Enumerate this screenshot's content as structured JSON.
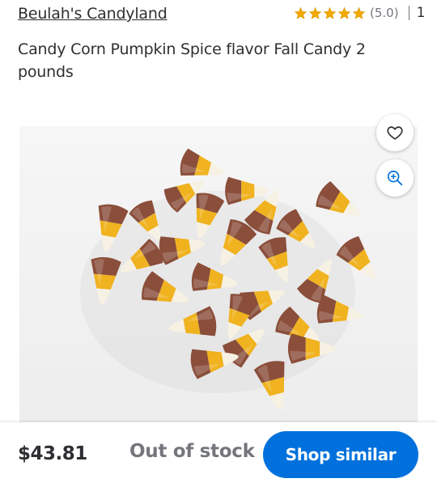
{
  "seller": {
    "name": "Beulah's Candyland"
  },
  "rating": {
    "stars": 5,
    "value_text": "(5.0)",
    "review_count": "1",
    "star_color": "#f2a900"
  },
  "product": {
    "title": "Candy Corn Pumpkin Spice flavor Fall Candy 2 pounds"
  },
  "image_actions": {
    "favorite_icon": "heart-icon",
    "zoom_icon": "zoom-in-icon",
    "icon_color": "#0071dc"
  },
  "purchase": {
    "price": "$43.81",
    "stock_status": "Out of stock",
    "shop_similar_label": "Shop similar",
    "button_color": "#0071dc"
  }
}
